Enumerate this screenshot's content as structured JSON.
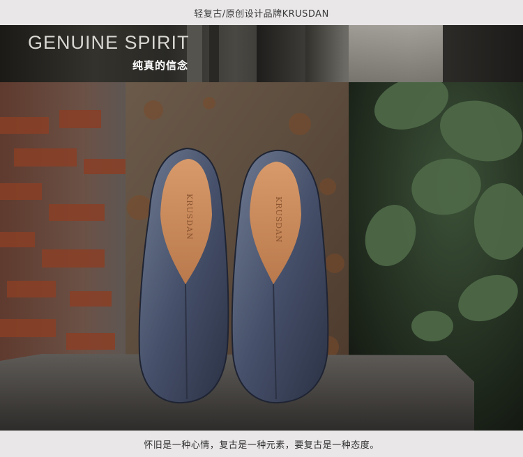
{
  "header": {
    "title": "轻复古/原创设计品牌KRUSDAN"
  },
  "banner": {
    "headline": "GENUINE SPIRIT",
    "subheadline": "纯真的信念"
  },
  "photo": {
    "insole_brand": "KRUSDAN"
  },
  "footer": {
    "caption": "怀旧是一种心情，复古是一种元素，要复古是一种态度。"
  }
}
